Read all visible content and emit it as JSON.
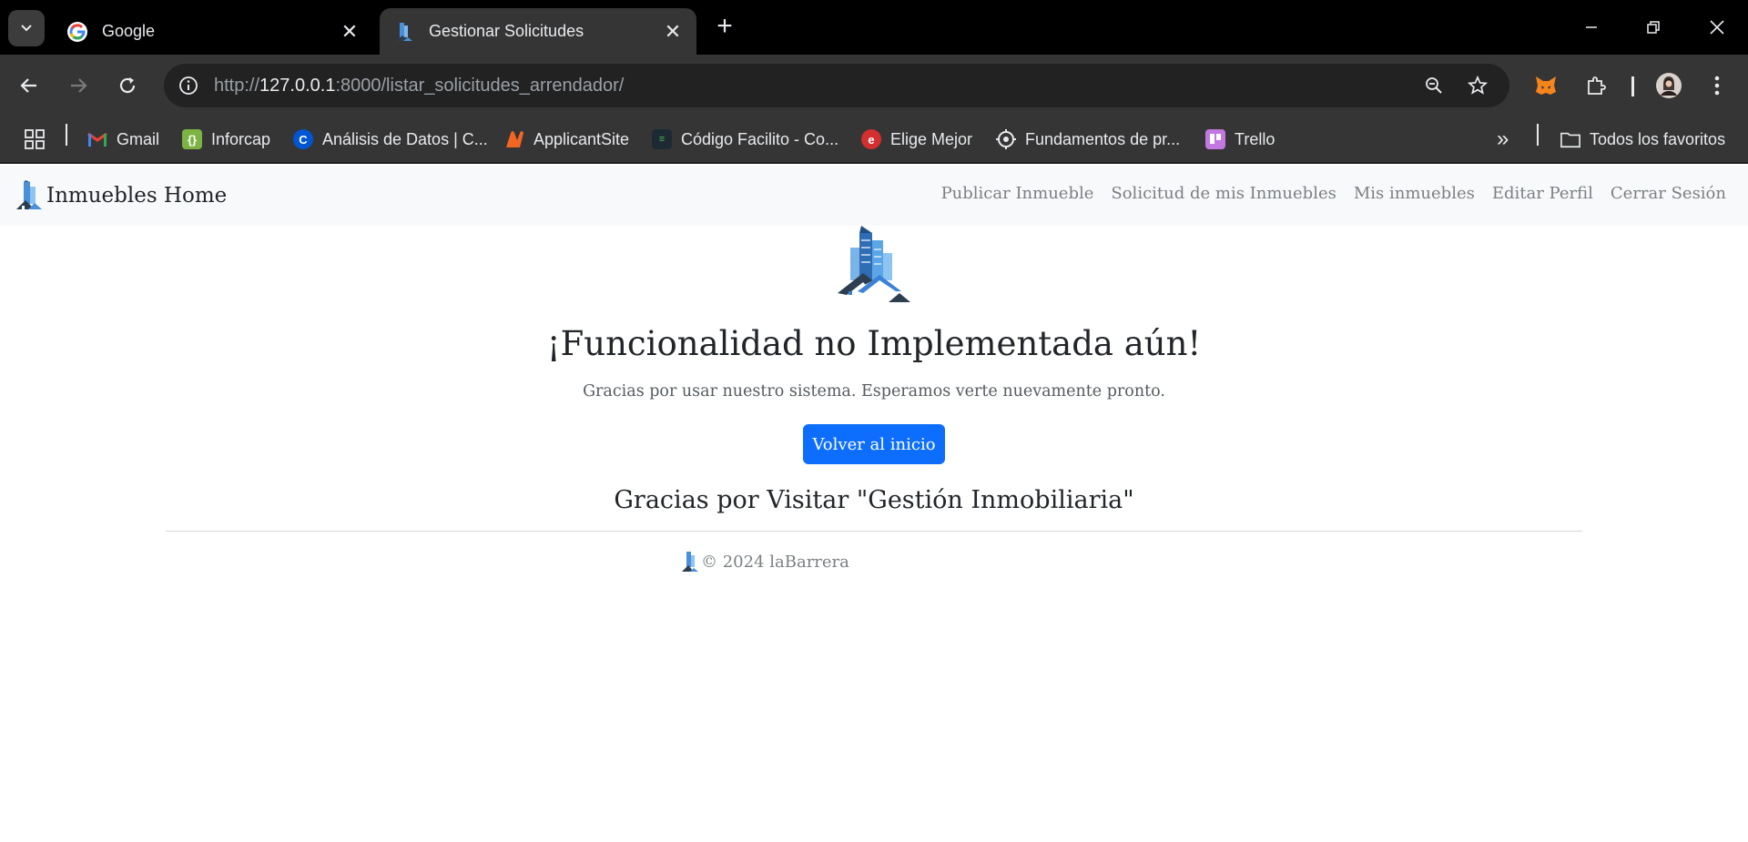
{
  "browser": {
    "tabs": [
      {
        "title": "Google",
        "active": false,
        "favicon": "google-icon"
      },
      {
        "title": "Gestionar Solicitudes",
        "active": true,
        "favicon": "building-icon"
      }
    ],
    "url": {
      "scheme": "http://",
      "host": "127.0.0.1",
      "rest": ":8000/listar_solicitudes_arrendador/"
    },
    "bookmarks": [
      {
        "label": "Gmail",
        "icon": "gmail-icon"
      },
      {
        "label": "Inforcap",
        "icon": "inforcap-icon"
      },
      {
        "label": "Análisis de Datos | C...",
        "icon": "coursera-icon"
      },
      {
        "label": "ApplicantSite",
        "icon": "applicantsite-icon"
      },
      {
        "label": "Código Facilito - Co...",
        "icon": "codigofacilito-icon"
      },
      {
        "label": "Elige Mejor",
        "icon": "eligemejor-icon"
      },
      {
        "label": "Fundamentos de pr...",
        "icon": "fundamentos-icon"
      },
      {
        "label": "Trello",
        "icon": "trello-icon"
      }
    ],
    "all_bookmarks_label": "Todos los favoritos"
  },
  "site": {
    "brand": "Inmuebles Home",
    "nav": [
      {
        "label": "Publicar Inmueble"
      },
      {
        "label": "Solicitud de mis Inmuebles"
      },
      {
        "label": "Mis inmuebles"
      },
      {
        "label": "Editar Perfil"
      },
      {
        "label": "Cerrar Sesión"
      }
    ]
  },
  "main": {
    "title": "¡Funcionalidad no Implementada aún!",
    "subtitle": "Gracias por usar nuestro sistema. Esperamos verte nuevamente pronto.",
    "button_label": "Volver al inicio",
    "thanks": "Gracias por Visitar \"Gestión Inmobiliaria\""
  },
  "footer": {
    "text": "© 2024 laBarrera"
  },
  "colors": {
    "primary": "#0d6efd",
    "navbar_bg": "#f8f9fa",
    "chrome_bg": "#353535"
  }
}
